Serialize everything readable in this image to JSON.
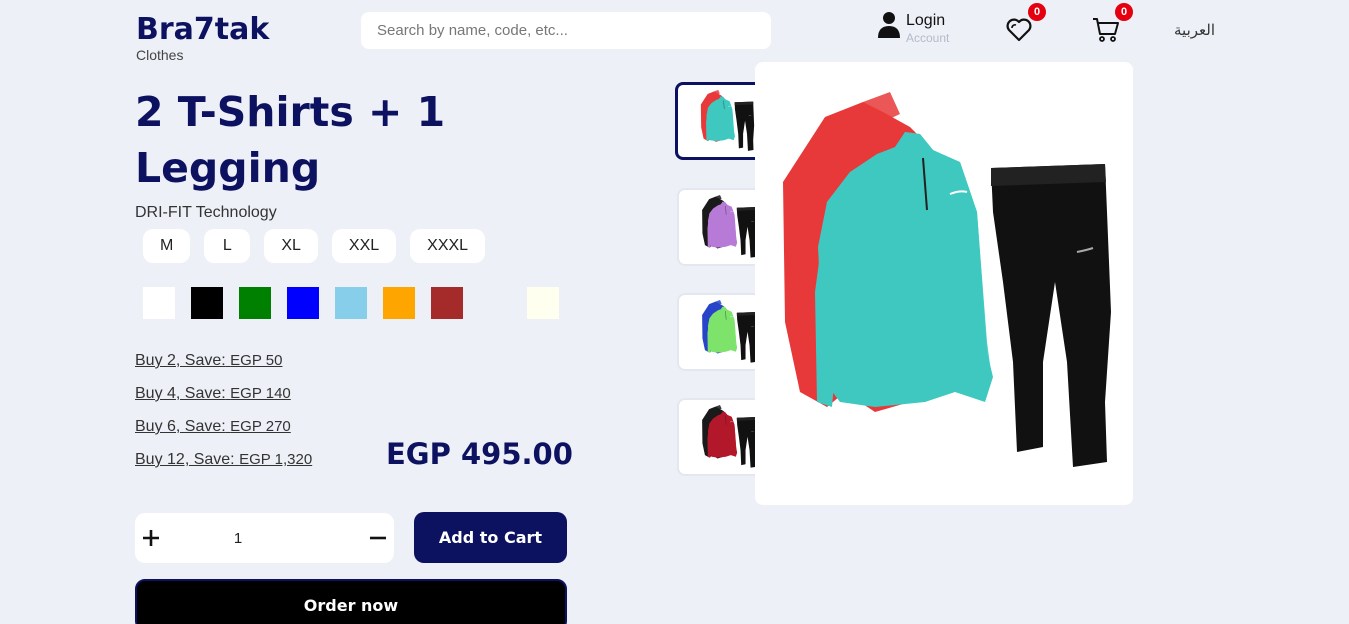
{
  "header": {
    "brand": "Bra7tak",
    "search_placeholder": "Search by name, code, etc...",
    "login_label": "Login",
    "login_sub": "Account",
    "wishlist_count": "0",
    "cart_count": "0",
    "language": "العربية"
  },
  "product": {
    "category": "Clothes",
    "title": "2 T-Shirts + 1 Legging",
    "subtitle": "DRI-FIT Technology",
    "sizes": [
      "M",
      "L",
      "XL",
      "XXL",
      "XXXL"
    ],
    "colors": [
      "#ffffff",
      "#000000",
      "#008000",
      "#0000ff",
      "#87ceeb",
      "#ffa500",
      "#a52a2a",
      "#eef0f8",
      "#fffff0"
    ],
    "offers": [
      {
        "label": "Buy 2, Save:",
        "amount": "EGP 50"
      },
      {
        "label": "Buy 4, Save:",
        "amount": "EGP 140"
      },
      {
        "label": "Buy 6, Save:",
        "amount": "EGP 270"
      },
      {
        "label": "Buy 12, Save:",
        "amount": "EGP 1,320"
      }
    ],
    "price": "EGP 495.00",
    "quantity": "1",
    "add_to_cart": "Add to Cart",
    "order_now": "Order now"
  },
  "gallery": {
    "thumbnails": [
      {
        "top_color": "#e8393a",
        "front_color": "#3fc8bf",
        "pants_color": "#111111"
      },
      {
        "top_color": "#1a1a1a",
        "front_color": "#b77ad6",
        "pants_color": "#111111"
      },
      {
        "top_color": "#2844c8",
        "front_color": "#7ee36b",
        "pants_color": "#111111"
      },
      {
        "top_color": "#1a1a1a",
        "front_color": "#b3172a",
        "pants_color": "#111111"
      }
    ],
    "main": {
      "top_color": "#e8393a",
      "front_color": "#3fc8bf",
      "pants_color": "#111111"
    }
  }
}
